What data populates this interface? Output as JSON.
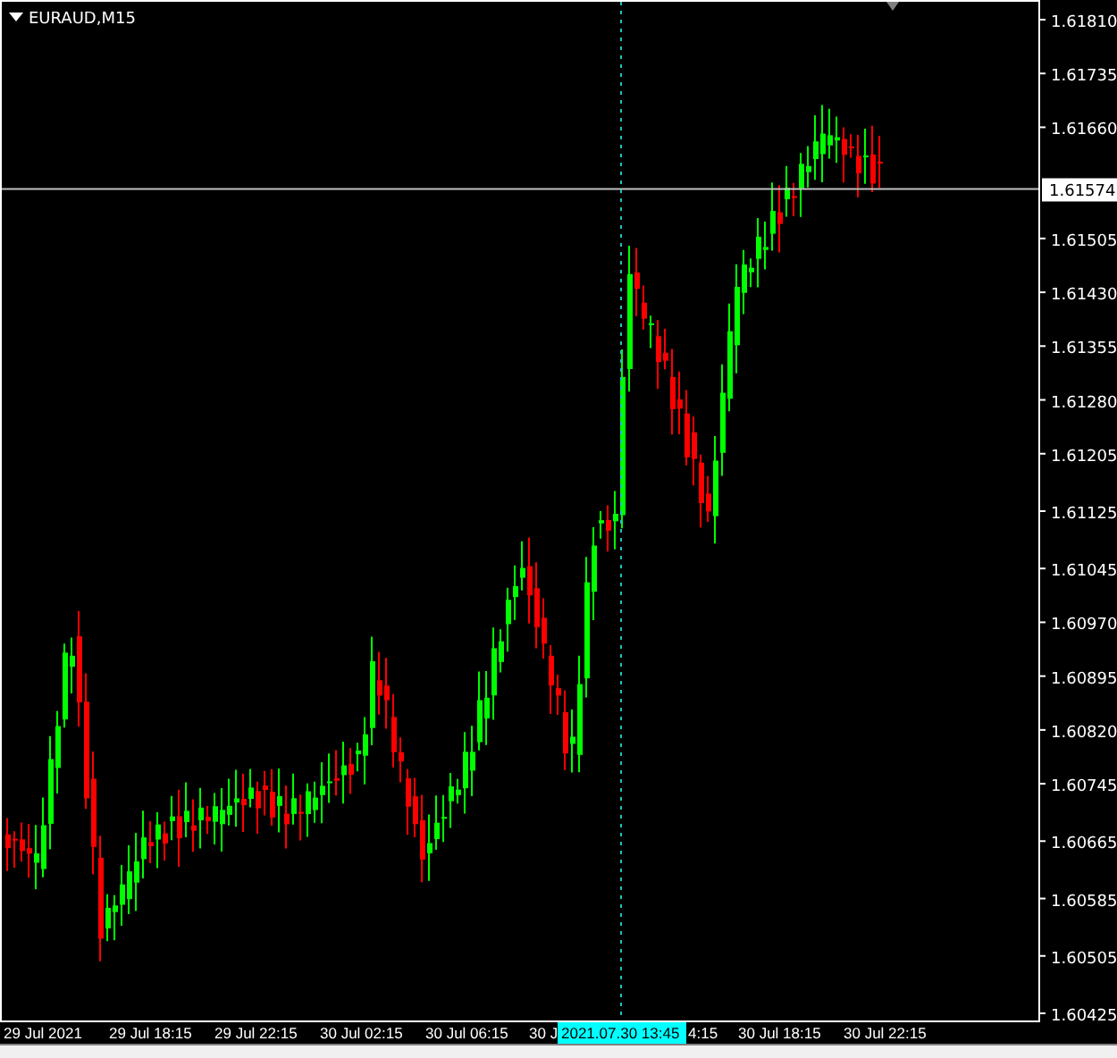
{
  "chart": {
    "title": "EURAUD,M15",
    "price_axis": [
      "1.61810",
      "1.61735",
      "1.61660",
      "1.61505",
      "1.61430",
      "1.61355",
      "1.61280",
      "1.61205",
      "1.61125",
      "1.61045",
      "1.60970",
      "1.60895",
      "1.60820",
      "1.60745",
      "1.60665",
      "1.60585",
      "1.60505",
      "1.60425"
    ],
    "current_price": "1.61574",
    "time_axis": [
      "29 Jul 2021",
      "29 Jul 18:15",
      "29 Jul 22:15",
      "30 Jul 02:15",
      "30 Jul 06:15",
      "30 J",
      "4:15",
      "30 Jul 18:15",
      "30 Jul 22:15"
    ],
    "crosshair_time": "2021.07.30 13:45"
  }
}
